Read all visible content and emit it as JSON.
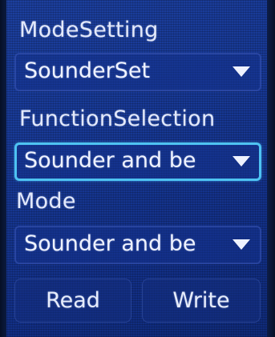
{
  "mode_setting": {
    "label": "ModeSetting",
    "selected": "SounderSet"
  },
  "function_selection": {
    "label": "FunctionSelection",
    "selected": "Sounder and be"
  },
  "mode": {
    "label": "Mode",
    "selected": "Sounder and be"
  },
  "buttons": {
    "read": "Read",
    "write": "Write"
  },
  "icons": {
    "dropdown_arrow": "triangle-down-icon"
  },
  "colors": {
    "background": "#173894",
    "focus_border": "#4ec3f2",
    "text": "#e9eefc"
  }
}
